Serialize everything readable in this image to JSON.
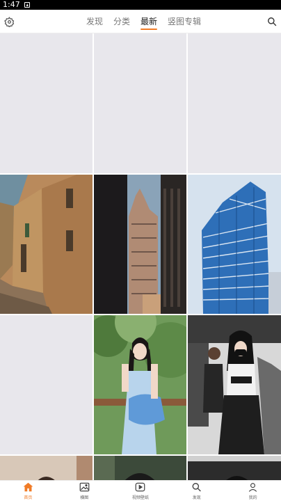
{
  "status_bar": {
    "time": "1:47"
  },
  "header": {
    "tabs": [
      {
        "label": "发现",
        "active": false
      },
      {
        "label": "分类",
        "active": false
      },
      {
        "label": "最新",
        "active": true
      },
      {
        "label": "竖图专辑",
        "active": false
      }
    ],
    "settings_icon": "settings-icon",
    "search_icon": "search-icon"
  },
  "grid": {
    "tiles": [
      {
        "content": "placeholder"
      },
      {
        "content": "placeholder"
      },
      {
        "content": "placeholder"
      },
      {
        "content": "stone-alley-photo"
      },
      {
        "content": "skyscraper-photo"
      },
      {
        "content": "glass-tower-photo"
      },
      {
        "content": "placeholder"
      },
      {
        "content": "girl-with-bag-photo"
      },
      {
        "content": "girl-in-mask-photo"
      },
      {
        "content": "partial-photo"
      },
      {
        "content": "partial-photo"
      },
      {
        "content": "partial-photo"
      }
    ]
  },
  "bottom_nav": {
    "items": [
      {
        "label": "首页",
        "icon": "home-icon",
        "active": true
      },
      {
        "label": "横图",
        "icon": "image-icon",
        "active": false
      },
      {
        "label": "视频壁纸",
        "icon": "play-icon",
        "active": false
      },
      {
        "label": "发现",
        "icon": "search-icon",
        "active": false
      },
      {
        "label": "我的",
        "icon": "user-icon",
        "active": false
      }
    ]
  },
  "colors": {
    "accent": "#f07b27",
    "placeholder": "#e8e7ec"
  }
}
